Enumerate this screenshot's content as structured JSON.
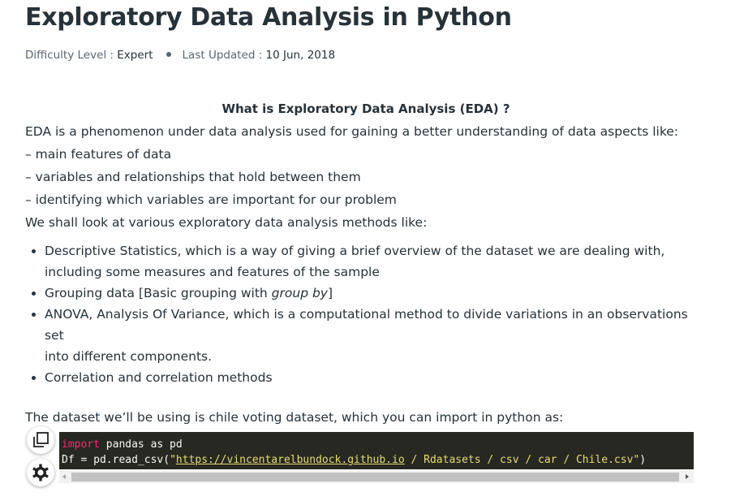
{
  "article": {
    "title": "Exploratory Data Analysis in Python",
    "difficulty_label": "Difficulty Level : ",
    "difficulty_value": "Expert",
    "updated_label": "Last Updated : ",
    "updated_value": "10 Jun, 2018",
    "heading": "What is Exploratory Data Analysis (EDA) ?",
    "intro": "EDA is a phenomenon under data analysis used for gaining a better understanding of data aspects like:",
    "aspects": [
      "– main features of data",
      "– variables and relationships that hold between them",
      "– identifying which variables are important for our problem"
    ],
    "methods_intro": "We shall look at various exploratory data analysis methods like:",
    "methods": {
      "descriptive": "Descriptive Statistics, which is a way of giving a brief overview of the dataset we are dealing with,",
      "descriptive_cont": "including some measures and features of the sample",
      "grouping_prefix": "Grouping data [Basic grouping with ",
      "grouping_em": "group by",
      "grouping_suffix": "]",
      "anova": "ANOVA, Analysis Of Variance, which is a computational method to divide variations in an observations set",
      "anova_cont": "into different components.",
      "correlation": "Correlation and correlation methods"
    },
    "dataset_intro": "The dataset we’ll be using is chile voting dataset, which you can import in python as:"
  },
  "code": {
    "line1_kw": "import",
    "line1_rest": " pandas as pd",
    "line2_pre": "Df = pd.read_csv(",
    "line2_quote_open": "\"",
    "line2_link": "https://vincentarelbundock.github.io",
    "line2_path": " / Rdatasets / csv / car / Chile.csv\"",
    "line2_close": ")"
  },
  "icons": {
    "copy": "copy-icon",
    "settings": "gear-icon"
  },
  "colors": {
    "text": "#273239",
    "code_bg": "#272822",
    "keyword": "#f92672",
    "string": "#e6db74"
  }
}
